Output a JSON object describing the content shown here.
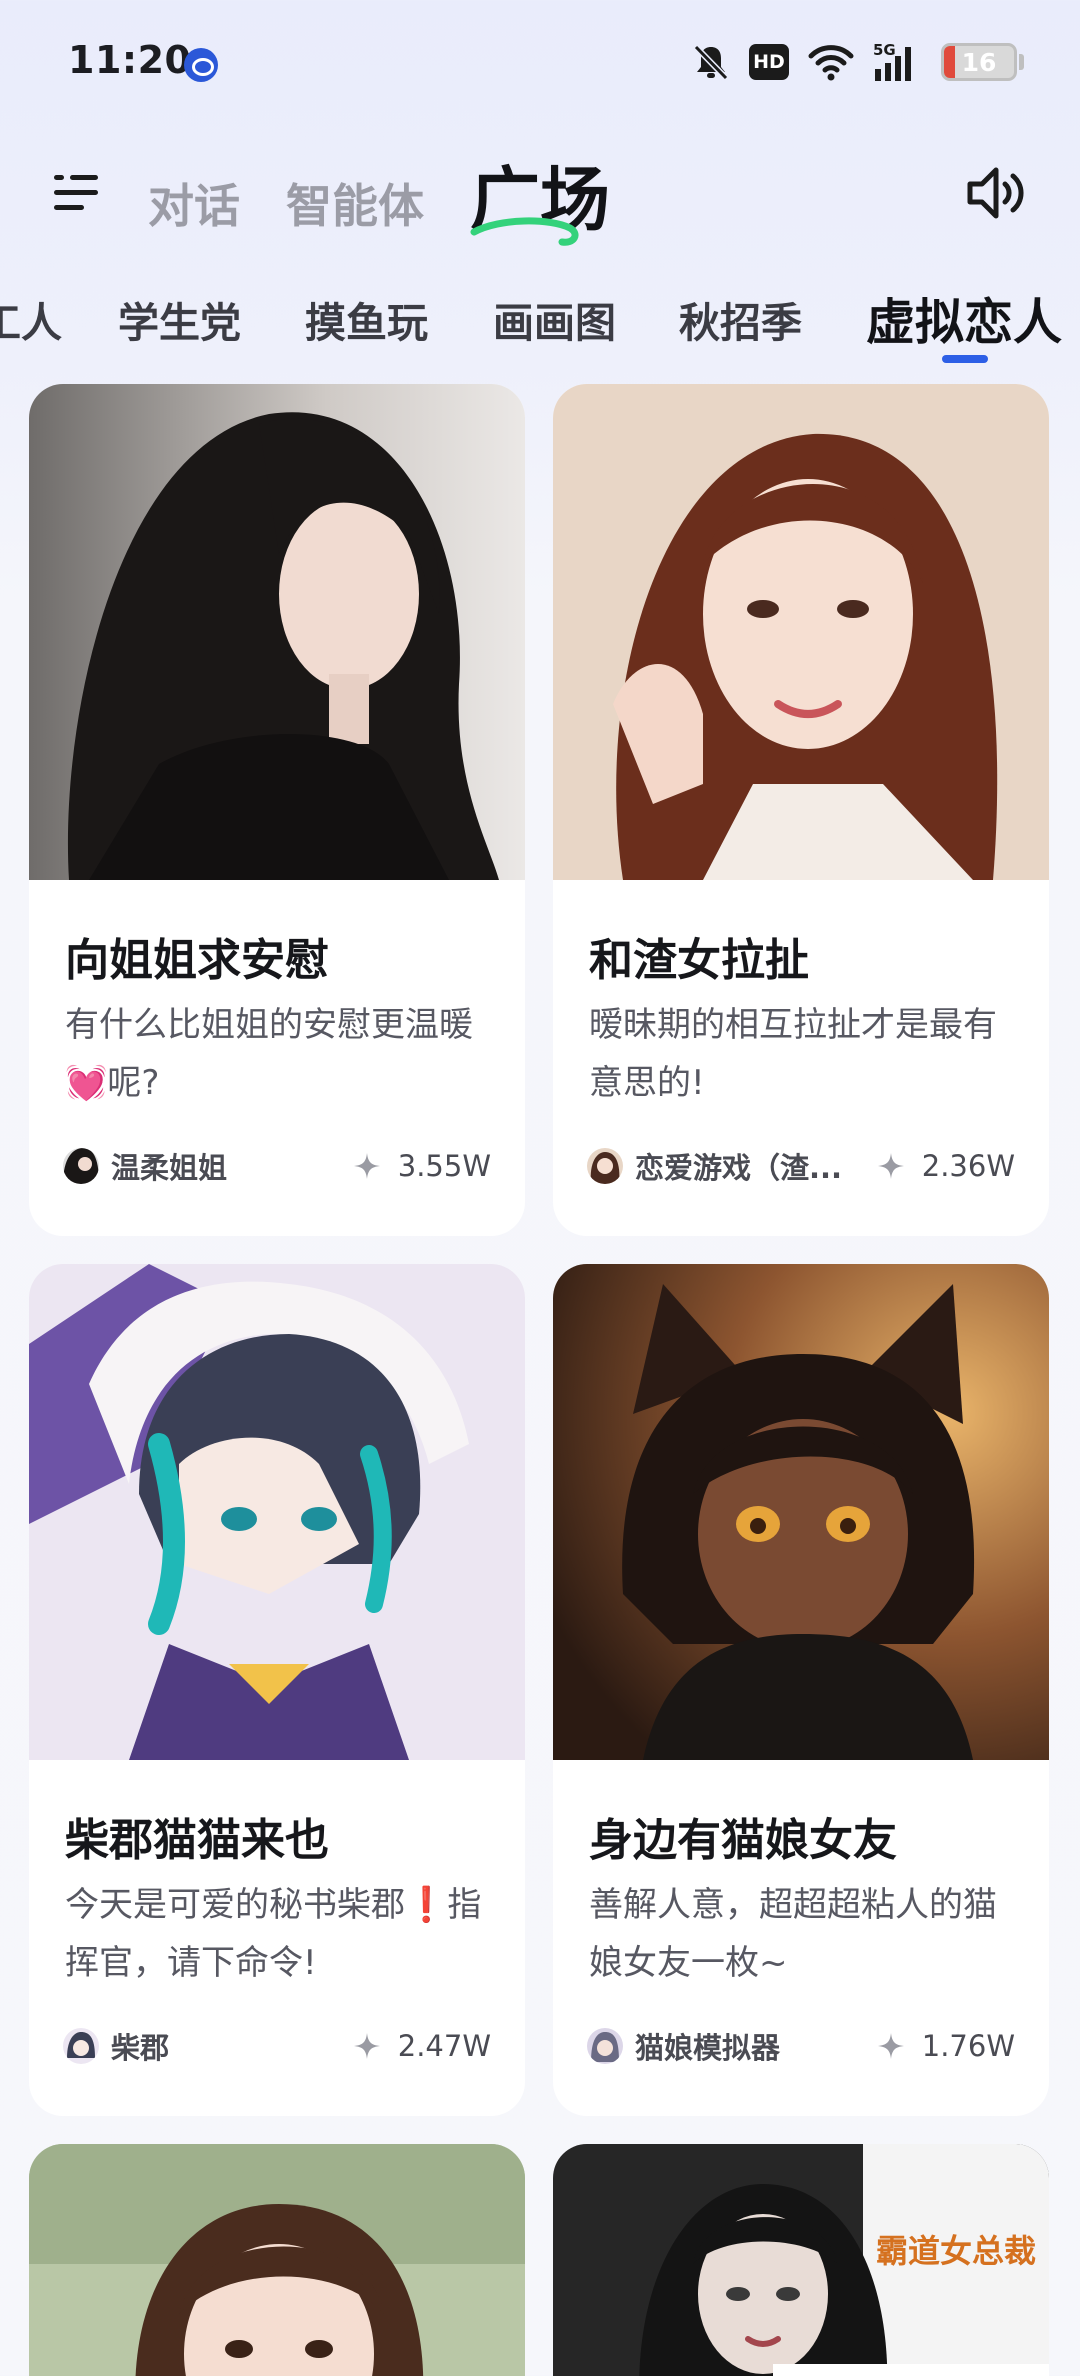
{
  "status_bar": {
    "time": "11:20",
    "hd_label": "HD",
    "network": "5G",
    "battery": "16",
    "battery_level": 0.16
  },
  "top_nav": {
    "tabs": [
      {
        "label": "对话"
      },
      {
        "label": "智能体"
      }
    ],
    "active_tab": "广场"
  },
  "categories": {
    "items": [
      "工人",
      "学生党",
      "摸鱼玩",
      "画画图",
      "秋招季",
      "虚拟恋人"
    ],
    "active_index": 5
  },
  "cards": [
    {
      "title": "向姐姐求安慰",
      "desc": "有什么比姐姐的安慰更温暖💓呢?",
      "author": "温柔姐姐",
      "count": "3.55W"
    },
    {
      "title": "和渣女拉扯",
      "desc": "暧昧期的相互拉扯才是最有意思的!",
      "author": "恋爱游戏（渣...",
      "count": "2.36W"
    },
    {
      "title": "柴郡猫猫来也",
      "desc": "今天是可爱的秘书柴郡❗指挥官，请下命令!",
      "author": "柴郡",
      "count": "2.47W"
    },
    {
      "title": "身边有猫娘女友",
      "desc": "善解人意，超超超粘人的猫娘女友一枚~",
      "author": "猫娘模拟器",
      "count": "1.76W"
    },
    {
      "image_text": "霸道女总裁"
    }
  ],
  "colors": {
    "accent": "#2d5fe6",
    "swoosh": "#34d27b",
    "battery_low": "#e04a3c"
  }
}
